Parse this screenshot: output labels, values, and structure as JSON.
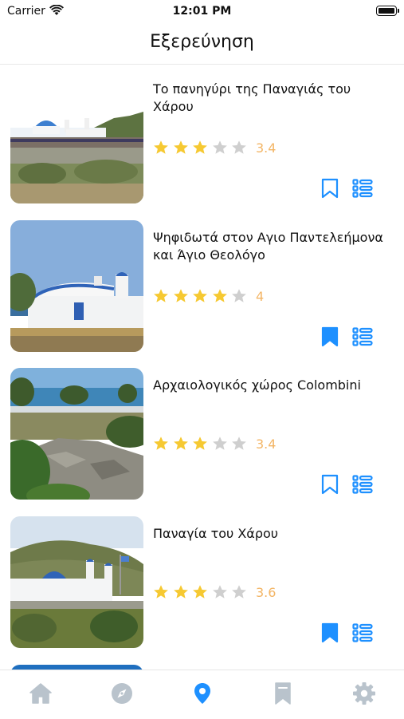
{
  "status_bar": {
    "carrier": "Carrier",
    "time": "12:01 PM"
  },
  "nav": {
    "title": "Εξερεύνηση"
  },
  "colors": {
    "accent": "#1e90ff",
    "star_on": "#f6c932",
    "star_off": "#cfcfcf",
    "rating_text": "#f3b565",
    "tab_inactive": "#b9c3cc"
  },
  "items": [
    {
      "title": "Το πανηγύρι της Παναγιάς του Χάρου",
      "rating": 3.4,
      "rating_label": "3.4",
      "stars_filled": 3,
      "bookmarked": false
    },
    {
      "title": "Ψηφιδωτά στον Αγιο Παντελεήμονα και Άγιο Θεολόγο",
      "rating": 4,
      "rating_label": "4",
      "stars_filled": 4,
      "bookmarked": true
    },
    {
      "title": "Αρχαιολογικός χώρος Colombini",
      "rating": 3.4,
      "rating_label": "3.4",
      "stars_filled": 3,
      "bookmarked": false
    },
    {
      "title": "Παναγία του Χάρου",
      "rating": 3.6,
      "rating_label": "3.6",
      "stars_filled": 3,
      "bookmarked": true
    }
  ],
  "tabs": [
    {
      "name": "home",
      "icon": "home-icon",
      "active": false
    },
    {
      "name": "explore",
      "icon": "compass-icon",
      "active": false
    },
    {
      "name": "map",
      "icon": "location-pin-icon",
      "active": true
    },
    {
      "name": "bookmarks",
      "icon": "bookmark-icon",
      "active": false
    },
    {
      "name": "settings",
      "icon": "gear-icon",
      "active": false
    }
  ]
}
